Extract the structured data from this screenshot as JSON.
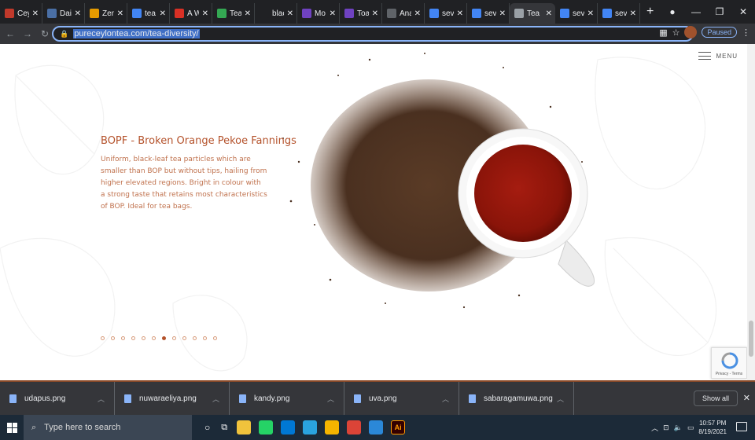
{
  "browser": {
    "tabs": [
      {
        "label": "Cey",
        "favicon_color": "#c0392b",
        "active": false
      },
      {
        "label": "Dail",
        "favicon_color": "#4a6fa5",
        "active": false
      },
      {
        "label": "Zen",
        "favicon_color": "#e69b00",
        "active": false
      },
      {
        "label": "tea",
        "favicon_color": "#4285f4",
        "active": false
      },
      {
        "label": "A W",
        "favicon_color": "#d93025",
        "active": false
      },
      {
        "label": "Tea",
        "favicon_color": "#34a853",
        "active": false
      },
      {
        "label": "blac",
        "favicon_color": "#202124",
        "active": false
      },
      {
        "label": "Mo",
        "favicon_color": "#6f42c1",
        "active": false
      },
      {
        "label": "Toa",
        "favicon_color": "#6f42c1",
        "active": false
      },
      {
        "label": "Ana",
        "favicon_color": "#5f6368",
        "active": false
      },
      {
        "label": "sev",
        "favicon_color": "#4285f4",
        "active": false
      },
      {
        "label": "sev",
        "favicon_color": "#4285f4",
        "active": false
      },
      {
        "label": "Tea",
        "favicon_color": "#9aa0a6",
        "active": true
      },
      {
        "label": "sev",
        "favicon_color": "#4285f4",
        "active": false
      },
      {
        "label": "sev",
        "favicon_color": "#4285f4",
        "active": false
      }
    ],
    "url": "pureceylontea.com/tea-diversity/",
    "profile_status": "Paused"
  },
  "page": {
    "menu_label": "MENU",
    "tea_title": "BOPF - Broken Orange Pekoe Fannings",
    "tea_description": "Uniform, black-leaf tea particles which are smaller than BOP but without tips, hailing from higher elevated regions. Bright in colour with a strong taste that retains most characteristics of BOP. Ideal for tea bags.",
    "pagination": {
      "total": 12,
      "active_index": 6
    },
    "recaptcha_text": "Privacy - Terms",
    "accent_color": "#b4522b"
  },
  "downloads": {
    "items": [
      {
        "name": "udapus.png"
      },
      {
        "name": "nuwaraeliya.png"
      },
      {
        "name": "kandy.png"
      },
      {
        "name": "uva.png"
      },
      {
        "name": "sabaragamuwa.png"
      }
    ],
    "show_all_label": "Show all"
  },
  "taskbar": {
    "search_placeholder": "Type here to search",
    "time": "10:57 PM",
    "date": "8/19/2021",
    "apps": [
      {
        "name": "file-explorer-icon",
        "color": "#f0c33c",
        "glyph": ""
      },
      {
        "name": "whatsapp-icon",
        "color": "#25d366",
        "glyph": ""
      },
      {
        "name": "vscode-icon",
        "color": "#0078d4",
        "glyph": ""
      },
      {
        "name": "telegram-icon",
        "color": "#2aa3df",
        "glyph": ""
      },
      {
        "name": "chrome-icon",
        "color": "#f4b400",
        "glyph": ""
      },
      {
        "name": "chrome-profile-icon",
        "color": "#db4437",
        "glyph": ""
      },
      {
        "name": "photos-icon",
        "color": "#2b88d8",
        "glyph": ""
      },
      {
        "name": "illustrator-icon",
        "color": "#330000",
        "glyph": "Ai"
      }
    ]
  }
}
